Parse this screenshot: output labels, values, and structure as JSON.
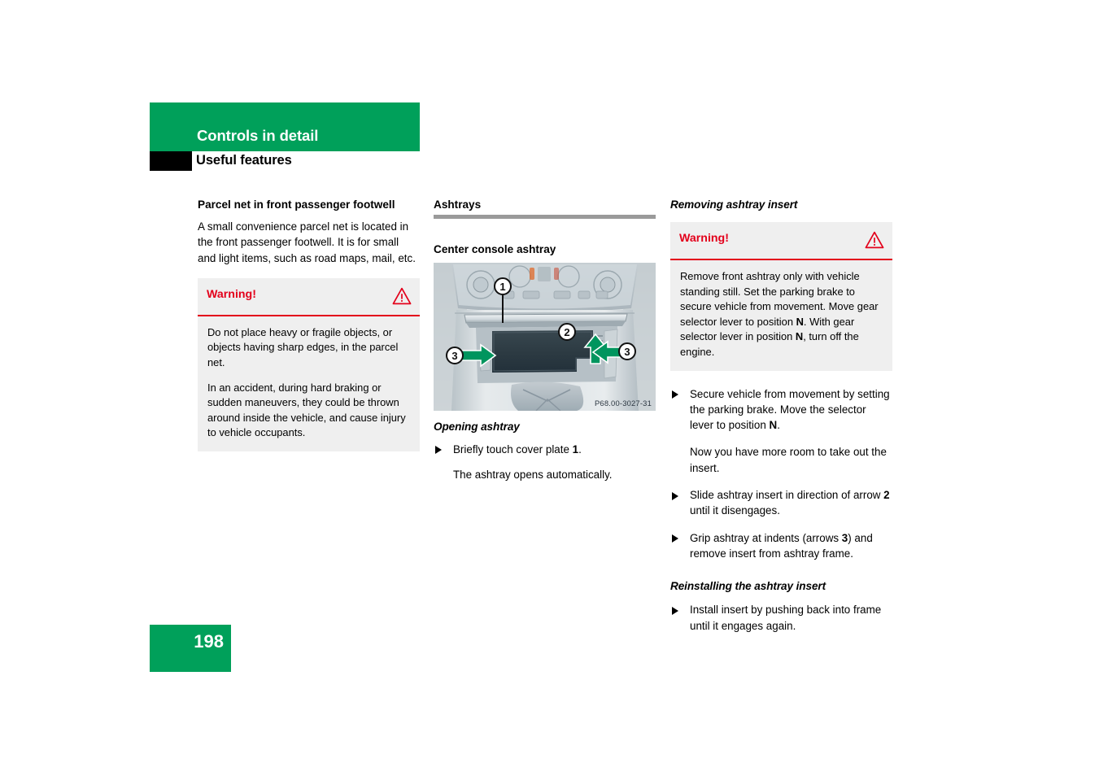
{
  "header": {
    "chapter_title": "Controls in detail",
    "section_title": "Useful features",
    "band_color": "#00a05a",
    "tab_color": "#000000"
  },
  "footer": {
    "page_number": "198",
    "box_color": "#00a05a"
  },
  "left_column": {
    "heading": "Parcel net in front passenger footwell",
    "intro": "A small convenience parcel net is located in the front passenger footwell. It is for small and light items, such as road maps, mail, etc.",
    "warning": {
      "label": "Warning!",
      "icon": "warning-triangle-icon",
      "accent_color": "#e3001b",
      "background_color": "#efefef",
      "paragraphs": [
        "Do not place heavy or fragile objects, or objects having sharp edges, in the parcel net.",
        "In an accident, during hard braking or sudden maneuvers, they could be thrown around inside the vehicle, and cause injury to vehicle occupants."
      ]
    }
  },
  "middle_column": {
    "heading": "Ashtrays",
    "rule_color": "#9a9a9a",
    "subheading": "Center console ashtray",
    "figure": {
      "caption_id": "P68.00-3027-31",
      "alt": "Center console with ashtray insert, callouts 1, 2 and 3 with green arrows",
      "callouts": [
        {
          "number": "1",
          "meaning": "cover plate"
        },
        {
          "number": "2",
          "meaning": "slide direction of ashtray insert"
        },
        {
          "number": "3",
          "meaning": "indent, left"
        },
        {
          "number": "3",
          "meaning": "indent, right"
        }
      ],
      "arrow_color": "#00955e"
    },
    "opening": {
      "heading": "Opening ashtray",
      "steps": [
        {
          "bullet": true,
          "text": "Briefly touch cover plate 1."
        },
        {
          "bullet": false,
          "text": "The ashtray opens automatically."
        }
      ]
    }
  },
  "right_column": {
    "heading": "Removing ashtray insert",
    "warning": {
      "label": "Warning!",
      "icon": "warning-triangle-icon",
      "accent_color": "#e3001b",
      "background_color": "#efefef",
      "paragraphs": [
        "Remove front ashtray only with vehicle standing still. Set the parking brake to secure vehicle from movement. Move gear selector lever to position N. With gear selector lever in position N, turn off the engine."
      ]
    },
    "steps": [
      {
        "bullet": true,
        "text": "Secure vehicle from movement by setting the parking brake. Move the selector lever to position N."
      },
      {
        "bullet": false,
        "text": "Now you have more room to take out the insert."
      },
      {
        "bullet": true,
        "text": "Slide ashtray insert in direction of arrow 2 until it disengages."
      },
      {
        "bullet": true,
        "text": "Grip ashtray at indents (arrows 3) and remove insert from ashtray frame."
      }
    ],
    "reinstall": {
      "heading": "Reinstalling the ashtray insert",
      "steps": [
        {
          "bullet": true,
          "text": "Install insert by pushing back into frame until it engages again."
        }
      ]
    }
  }
}
